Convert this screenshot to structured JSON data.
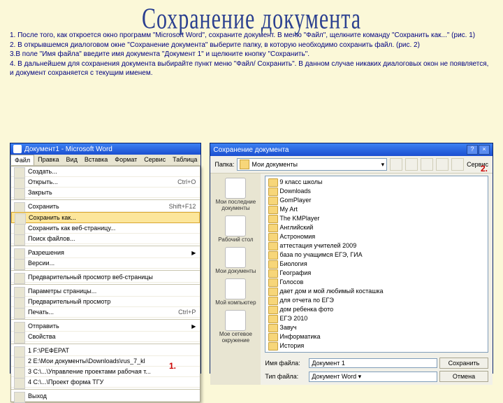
{
  "title": "Сохранение документа",
  "instructions": [
    "1. После того, как откроется окно программ \"Microsoft Word\", сохраните документ. В меню \"Файл\", щелкните команду \"Сохранить как...\" (рис. 1)",
    "2. В открывшемся диалоговом окне \"Сохранение документа\" выберите папку, в которую необходимо сохранить файл. (рис. 2)",
    "3.В поле \"Имя файла\" введите имя документа \"Документ 1\" и щелкните кнопку \"Сохранить\".",
    "4. В дальнейшем для сохранения документа выбирайте пункт меню \"Файл/ Сохранить\". В данном случае никаких диалоговых окон не появляется, и документ сохраняется с текущим именем."
  ],
  "word": {
    "title": "Документ1 - Microsoft Word",
    "menus": [
      "Файл",
      "Правка",
      "Вид",
      "Вставка",
      "Формат",
      "Сервис",
      "Таблица"
    ],
    "file_menu": [
      {
        "label": "Создать..."
      },
      {
        "label": "Открыть...",
        "shortcut": "Ctrl+O"
      },
      {
        "label": "Закрыть"
      },
      {
        "sep": true
      },
      {
        "label": "Сохранить",
        "shortcut": "Shift+F12"
      },
      {
        "label": "Сохранить как...",
        "hl": true
      },
      {
        "label": "Сохранить как веб-страницу..."
      },
      {
        "label": "Поиск файлов..."
      },
      {
        "sep": true
      },
      {
        "label": "Разрешения",
        "arrow": true
      },
      {
        "label": "Версии..."
      },
      {
        "sep": true
      },
      {
        "label": "Предварительный просмотр веб-страницы"
      },
      {
        "sep": true
      },
      {
        "label": "Параметры страницы..."
      },
      {
        "label": "Предварительный просмотр"
      },
      {
        "label": "Печать...",
        "shortcut": "Ctrl+P"
      },
      {
        "sep": true
      },
      {
        "label": "Отправить",
        "arrow": true
      },
      {
        "label": "Свойства"
      },
      {
        "sep": true
      },
      {
        "label": "1 F:\\РЕФЕРАТ"
      },
      {
        "label": "2 E:\\Мои документы\\Downloads\\rus_7_kl"
      },
      {
        "label": "3 C:\\...\\Управление проектами рабочая т..."
      },
      {
        "label": "4 C:\\...\\Проект форма ТГУ"
      },
      {
        "sep": true
      },
      {
        "label": "Выход"
      }
    ]
  },
  "dialog": {
    "title": "Сохранение документа",
    "folder_label": "Папка:",
    "folder_value": "Мои документы",
    "service_label": "Сервис",
    "places": [
      "Мои последние документы",
      "Рабочий стол",
      "Мои документы",
      "Мой компьютер",
      "Мое сетевое окружение"
    ],
    "files": [
      "9 класс школы",
      "Downloads",
      "GomPlayer",
      "My Art",
      "The KMPlayer",
      "Английский",
      "Астрономия",
      "аттестация учителей 2009",
      "база по учащимся ЕГЭ, ГИА",
      "Биология",
      "География",
      "Голосов",
      "дает дом и мой любимый косташка",
      "для отчета по ЕГЭ",
      "дом ребенка фото",
      "ЕГЭ 2010",
      "Завуч",
      "Информатика",
      "История"
    ],
    "filename_label": "Имя файла:",
    "filename_value": "Документ 1",
    "filetype_label": "Тип файла:",
    "filetype_value": "Документ Word",
    "save": "Сохранить",
    "cancel": "Отмена"
  },
  "annot": {
    "n1": "1.",
    "n2": "2."
  }
}
